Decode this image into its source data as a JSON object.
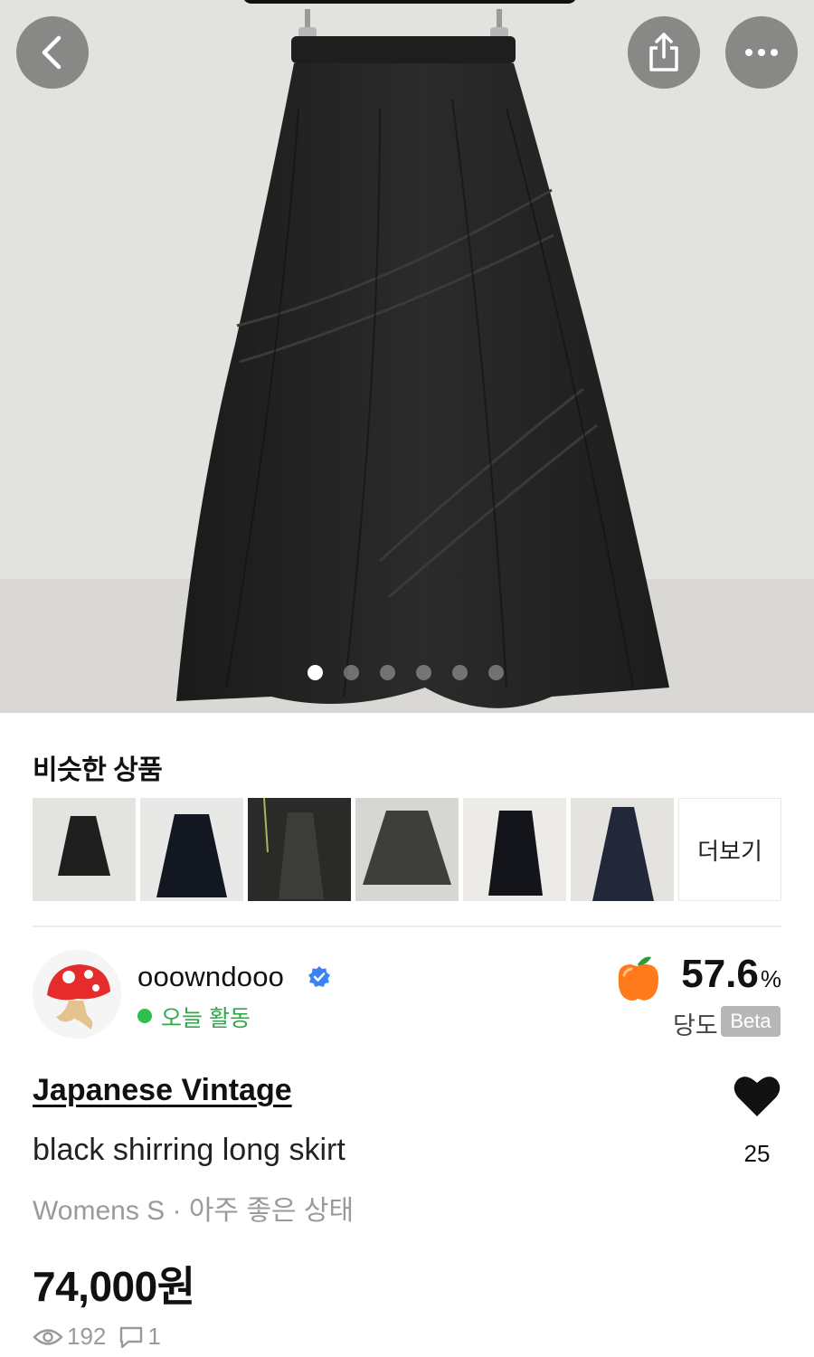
{
  "header": {
    "back_icon": "chevron-left-icon",
    "share_icon": "share-icon",
    "more_icon": "ellipsis-icon"
  },
  "gallery": {
    "image": "black-shirring-skirt-photo",
    "image_count": 6,
    "active_index": 0
  },
  "similar": {
    "title": "비슷한 상품",
    "more_label": "더보기",
    "thumb_count": 6
  },
  "seller": {
    "name": "ooowndooo",
    "active_label": "오늘 활동",
    "verified_icon": "verified-badge-icon",
    "score_value": "57.6",
    "score_unit": "%",
    "score_label": "당도",
    "beta_label": "Beta"
  },
  "product": {
    "brand": "Japanese Vintage",
    "title": "black shirring long skirt",
    "meta": "Womens S · 아주 좋은 상태",
    "price": "74,000원",
    "likes": "25",
    "views": "192",
    "comments": "1"
  },
  "colors": {
    "active_green": "#2fbf4f",
    "apple_orange": "#ff7a1a",
    "verified_blue": "#3b82f6"
  }
}
